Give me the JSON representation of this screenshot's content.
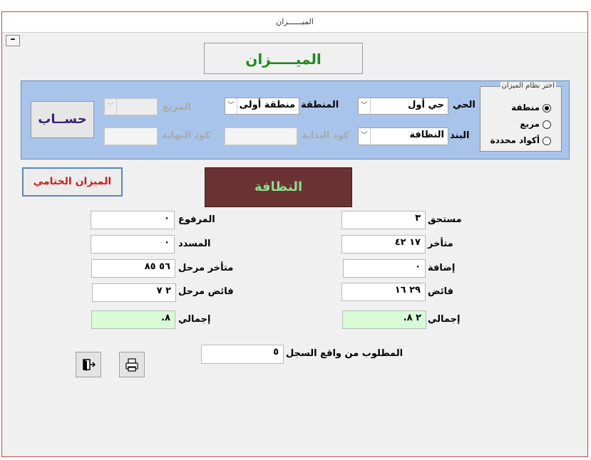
{
  "window": {
    "title": "الميــــــزان"
  },
  "header": {
    "title": "الميـــــزان"
  },
  "filters": {
    "district_label": "الحي",
    "district_value": "حي أول",
    "item_label": "البند",
    "item_value": "النظافة",
    "area_label": "المنطقة",
    "area_value": "منطقة أولى",
    "start_code_label": "كود البداية",
    "square_label": "المربع",
    "end_code_label": "كود النهاية",
    "calc_button": "حســاب"
  },
  "system": {
    "legend": "اختر نظام الميزان",
    "options": [
      "منطقة",
      "مربع",
      "أكواد محددة"
    ],
    "selected_index": 0
  },
  "actions": {
    "final_balance": "الميزان الختامي"
  },
  "category": {
    "label": "النظافة"
  },
  "left": {
    "due_label": "مستحق",
    "due_value": "٣",
    "overdue_label": "متأخر",
    "overdue_value": "١٧ ٤٢",
    "addition_label": "إضافة",
    "addition_value": "٠",
    "surplus_label": "فائض",
    "surplus_value": "٢٩ ١٦",
    "total_label": "إجمالي",
    "total_value": "٢ ٨."
  },
  "right": {
    "raised_label": "المرفوع",
    "raised_value": "٠",
    "paid_label": "المسدد",
    "paid_value": "٠",
    "carried_overdue_label": "متأخر مرحل",
    "carried_overdue_value": "٥٦ ٨٥",
    "carried_surplus_label": "فائض مرحل",
    "carried_surplus_value": "٢ ٧",
    "total_label": "إجمالي",
    "total_value": "٨."
  },
  "required": {
    "label": "المطلوب من واقع السجل",
    "value": "٥"
  }
}
